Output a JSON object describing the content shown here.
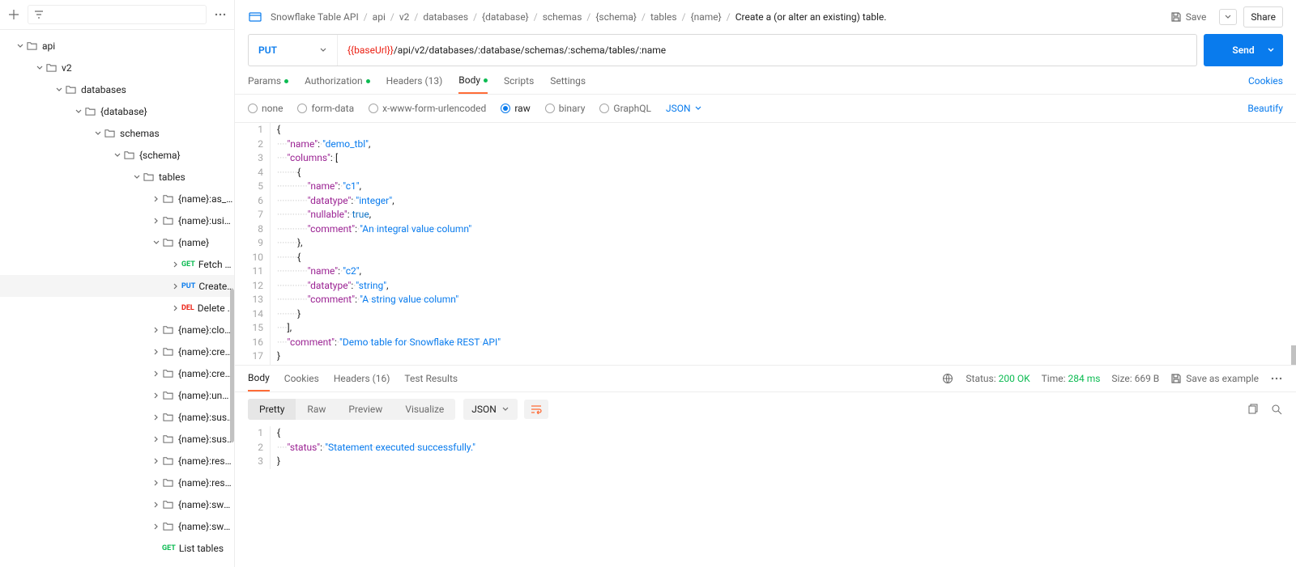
{
  "sidebar": {
    "tree": [
      {
        "indent": 18,
        "caret": "down",
        "icon": "folder",
        "label": "api"
      },
      {
        "indent": 42,
        "caret": "down",
        "icon": "folder",
        "label": "v2"
      },
      {
        "indent": 66,
        "caret": "down",
        "icon": "folder",
        "label": "databases"
      },
      {
        "indent": 90,
        "caret": "down",
        "icon": "folder",
        "label": "{database}"
      },
      {
        "indent": 114,
        "caret": "down",
        "icon": "folder",
        "label": "schemas"
      },
      {
        "indent": 138,
        "caret": "down",
        "icon": "folder",
        "label": "{schema}"
      },
      {
        "indent": 162,
        "caret": "down",
        "icon": "folder",
        "label": "tables"
      },
      {
        "indent": 186,
        "caret": "right",
        "icon": "folder",
        "label": "{name}:as_sel..."
      },
      {
        "indent": 186,
        "caret": "right",
        "icon": "folder",
        "label": "{name}:using_..."
      },
      {
        "indent": 186,
        "caret": "down",
        "icon": "folder",
        "label": "{name}"
      },
      {
        "indent": 210,
        "caret": "right",
        "method": "GET",
        "label": "Fetch a table."
      },
      {
        "indent": 210,
        "caret": "right",
        "method": "PUT",
        "label": "Create a (or...",
        "selected": true
      },
      {
        "indent": 210,
        "caret": "right",
        "method": "DEL",
        "label": "Delete a ta..."
      },
      {
        "indent": 186,
        "caret": "right",
        "icon": "folder",
        "label": "{name}:clone"
      },
      {
        "indent": 186,
        "caret": "right",
        "icon": "folder",
        "label": "{name}:create..."
      },
      {
        "indent": 186,
        "caret": "right",
        "icon": "folder",
        "label": "{name}:create..."
      },
      {
        "indent": 186,
        "caret": "right",
        "icon": "folder",
        "label": "{name}:undrop"
      },
      {
        "indent": 186,
        "caret": "right",
        "icon": "folder",
        "label": "{name}:suspe..."
      },
      {
        "indent": 186,
        "caret": "right",
        "icon": "folder",
        "label": "{name}:suspe..."
      },
      {
        "indent": 186,
        "caret": "right",
        "icon": "folder",
        "label": "{name}:resum..."
      },
      {
        "indent": 186,
        "caret": "right",
        "icon": "folder",
        "label": "{name}:resum..."
      },
      {
        "indent": 186,
        "caret": "right",
        "icon": "folder",
        "label": "{name}:swap..."
      },
      {
        "indent": 186,
        "caret": "right",
        "icon": "folder",
        "label": "{name}:swap-..."
      },
      {
        "indent": 186,
        "caret": "none",
        "method": "GET",
        "label": "List tables"
      }
    ]
  },
  "breadcrumb": [
    "Snowflake Table API",
    "api",
    "v2",
    "databases",
    "{database}",
    "schemas",
    "{schema}",
    "tables",
    "{name}",
    "Create a (or alter an existing) table."
  ],
  "topbar": {
    "save": "Save",
    "share": "Share"
  },
  "request": {
    "method": "PUT",
    "url_var": "{{baseUrl}}",
    "url_rest": "/api/v2/databases/:database/schemas/:schema/tables/:name",
    "send": "Send",
    "tabs": {
      "params": "Params",
      "auth": "Authorization",
      "headers": "Headers (13)",
      "body": "Body",
      "scripts": "Scripts",
      "settings": "Settings",
      "cookies": "Cookies"
    },
    "body_format": {
      "none": "none",
      "form": "form-data",
      "xwww": "x-www-form-urlencoded",
      "raw": "raw",
      "binary": "binary",
      "graphql": "GraphQL",
      "json": "JSON",
      "beautify": "Beautify"
    },
    "body_lines": [
      "{",
      "····\"name\":·\"demo_tbl\",",
      "····\"columns\":·[",
      "········{",
      "············\"name\":·\"c1\",",
      "············\"datatype\":·\"integer\",",
      "············\"nullable\":·true,",
      "············\"comment\":·\"An·integral·value·column\"",
      "········},",
      "········{",
      "············\"name\":·\"c2\",",
      "············\"datatype\":·\"string\",",
      "············\"comment\":·\"A·string·value·column\"",
      "········}",
      "····],",
      "····\"comment\":·\"Demo·table·for·Snowflake·REST·API\"",
      "}"
    ]
  },
  "response": {
    "tabs": {
      "body": "Body",
      "cookies": "Cookies",
      "headers": "Headers (16)",
      "tests": "Test Results"
    },
    "status_label": "Status:",
    "status_value": "200 OK",
    "time_label": "Time:",
    "time_value": "284 ms",
    "size_label": "Size:",
    "size_value": "669 B",
    "save_example": "Save as example",
    "views": {
      "pretty": "Pretty",
      "raw": "Raw",
      "preview": "Preview",
      "visualize": "Visualize",
      "json": "JSON"
    },
    "body_lines": [
      "{",
      "····\"status\":·\"Statement·executed·successfully.\"",
      "}"
    ]
  }
}
